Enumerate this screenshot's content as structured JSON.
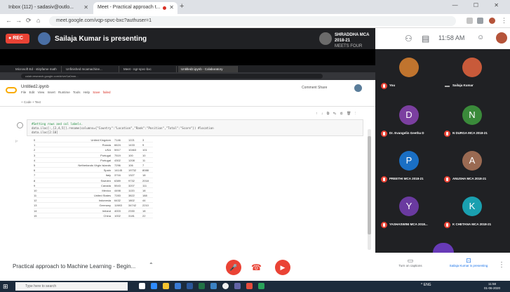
{
  "browser": {
    "tabs": [
      {
        "label": "Inbox (112) - sadasiv@outlo...",
        "active": false
      },
      {
        "label": "Meet - Practical approach t...",
        "active": true
      }
    ],
    "address": "meet.google.com/vqp-spvc-bxc?authuser=1"
  },
  "meet": {
    "rec_label": "REC",
    "presenting_text": "Sailaja Kumar is presenting",
    "sharing_name": "SHRADDHA MCA 2018-21",
    "sharing_sub": "MEETS FOUR",
    "time": "11:58 AM"
  },
  "shared_screen": {
    "inner_tabs": [
      "Microsoft Ed - stirpfame math",
      "Unfinished mcamachine...",
      "Meet - ngr-spvc-bxc",
      "Untitled2.ipynb - Colaboratory"
    ],
    "inner_address": "colab.research.google.com/drive/1a0mm...",
    "notebook_title": "Untitled2.ipynb",
    "menu": [
      "File",
      "Edit",
      "View",
      "Insert",
      "Runtime",
      "Tools",
      "Help",
      "Save failed"
    ],
    "right_actions": "Comment  Share",
    "toolbar_text": "+ Code  + Text",
    "code_lines": [
      "#Setting rows and col labels.",
      "data.iloc[:,[2,4,5]].rename(columns={\"Country\":\"Location\",\"Rank\":\"Position\",\"Total\":\"Score\"}) #location",
      "data.iloc[2:10]"
    ],
    "cell_tools": "↑ ↓ ⧉ ✎ ⚙ 🗑 ⋮",
    "table_rows": [
      {
        "idx": "0",
        "name": "United Kingdom",
        "a": "7146",
        "b": "1221",
        "c": "3"
      },
      {
        "idx": "1",
        "name": "Russia",
        "a": "6624",
        "b": "1433",
        "c": "9"
      },
      {
        "idx": "2",
        "name": "USA",
        "a": "5917",
        "b": "10463",
        "c": "101"
      },
      {
        "idx": "3",
        "name": "Portugal",
        "a": "7519",
        "b": "100",
        "c": "10"
      },
      {
        "idx": "4",
        "name": "Portugal",
        "a": "4302",
        "b": "1208",
        "c": "11"
      },
      {
        "idx": "5",
        "name": "Netherlands Virgin Islands",
        "a": "7296",
        "b": "106",
        "c": "7"
      },
      {
        "idx": "6",
        "name": "Spain",
        "a": "14145",
        "b": "19732",
        "c": "8088"
      },
      {
        "idx": "7",
        "name": "Italy",
        "a": "3716",
        "b": "1327",
        "c": "18"
      },
      {
        "idx": "8",
        "name": "Sweden",
        "a": "6389",
        "b": "9732",
        "c": "2018"
      },
      {
        "idx": "9",
        "name": "Canada",
        "a": "5543",
        "b": "3207",
        "c": "111"
      },
      {
        "idx": "10",
        "name": "Mexico",
        "a": "4498",
        "b": "1133",
        "c": "18"
      },
      {
        "idx": "11",
        "name": "United States",
        "a": "7283",
        "b": "3822",
        "c": "188"
      },
      {
        "idx": "12",
        "name": "Indonesia",
        "a": "6432",
        "b": "1802",
        "c": "44"
      },
      {
        "idx": "13",
        "name": "Germany",
        "a": "11983",
        "b": "34742",
        "c": "2210"
      },
      {
        "idx": "14",
        "name": "Ireland",
        "a": "4003",
        "b": "2330",
        "c": "18"
      },
      {
        "idx": "15",
        "name": "China",
        "a": "1002",
        "b": "3181",
        "c": "22"
      }
    ]
  },
  "participants": [
    {
      "name": "You",
      "initial": "",
      "color": "#c0742e",
      "photo": true,
      "muted": true
    },
    {
      "name": "Sailaja Kumar",
      "initial": "",
      "color": "#c85a3a",
      "photo": true,
      "muted": false
    },
    {
      "name": "Dr. Evangelin Geetha D",
      "initial": "D",
      "color": "#7b3fa0",
      "photo": false,
      "muted": true
    },
    {
      "name": "N DURGA MCA 2018-21",
      "initial": "N",
      "color": "#3a8a3a",
      "photo": false,
      "muted": true
    },
    {
      "name": "PREETHI MCA 2018-21",
      "initial": "P",
      "color": "#1a6fc4",
      "photo": false,
      "muted": true
    },
    {
      "name": "ANUSHA MCA 2018-21",
      "initial": "A",
      "color": "#9a6a52",
      "photo": false,
      "muted": true
    },
    {
      "name": "YASHASWINI MCA 2018...",
      "initial": "Y",
      "color": "#6a3aa0",
      "photo": false,
      "muted": true
    },
    {
      "name": "K CHETANA MCA 2018-21",
      "initial": "K",
      "color": "#1aa0b0",
      "photo": false,
      "muted": true
    }
  ],
  "bottom_bar": {
    "meeting_title": "Practical approach to Machine Learning - Begin...",
    "present_label": "Turn on captions",
    "present_now_label": "Sailaja Kumar is presenting",
    "more_label": "⋮"
  },
  "taskbar": {
    "search_placeholder": "Type here to search",
    "tray_text": "^ ENG",
    "time": "11:58",
    "date": "01-06-2020"
  }
}
